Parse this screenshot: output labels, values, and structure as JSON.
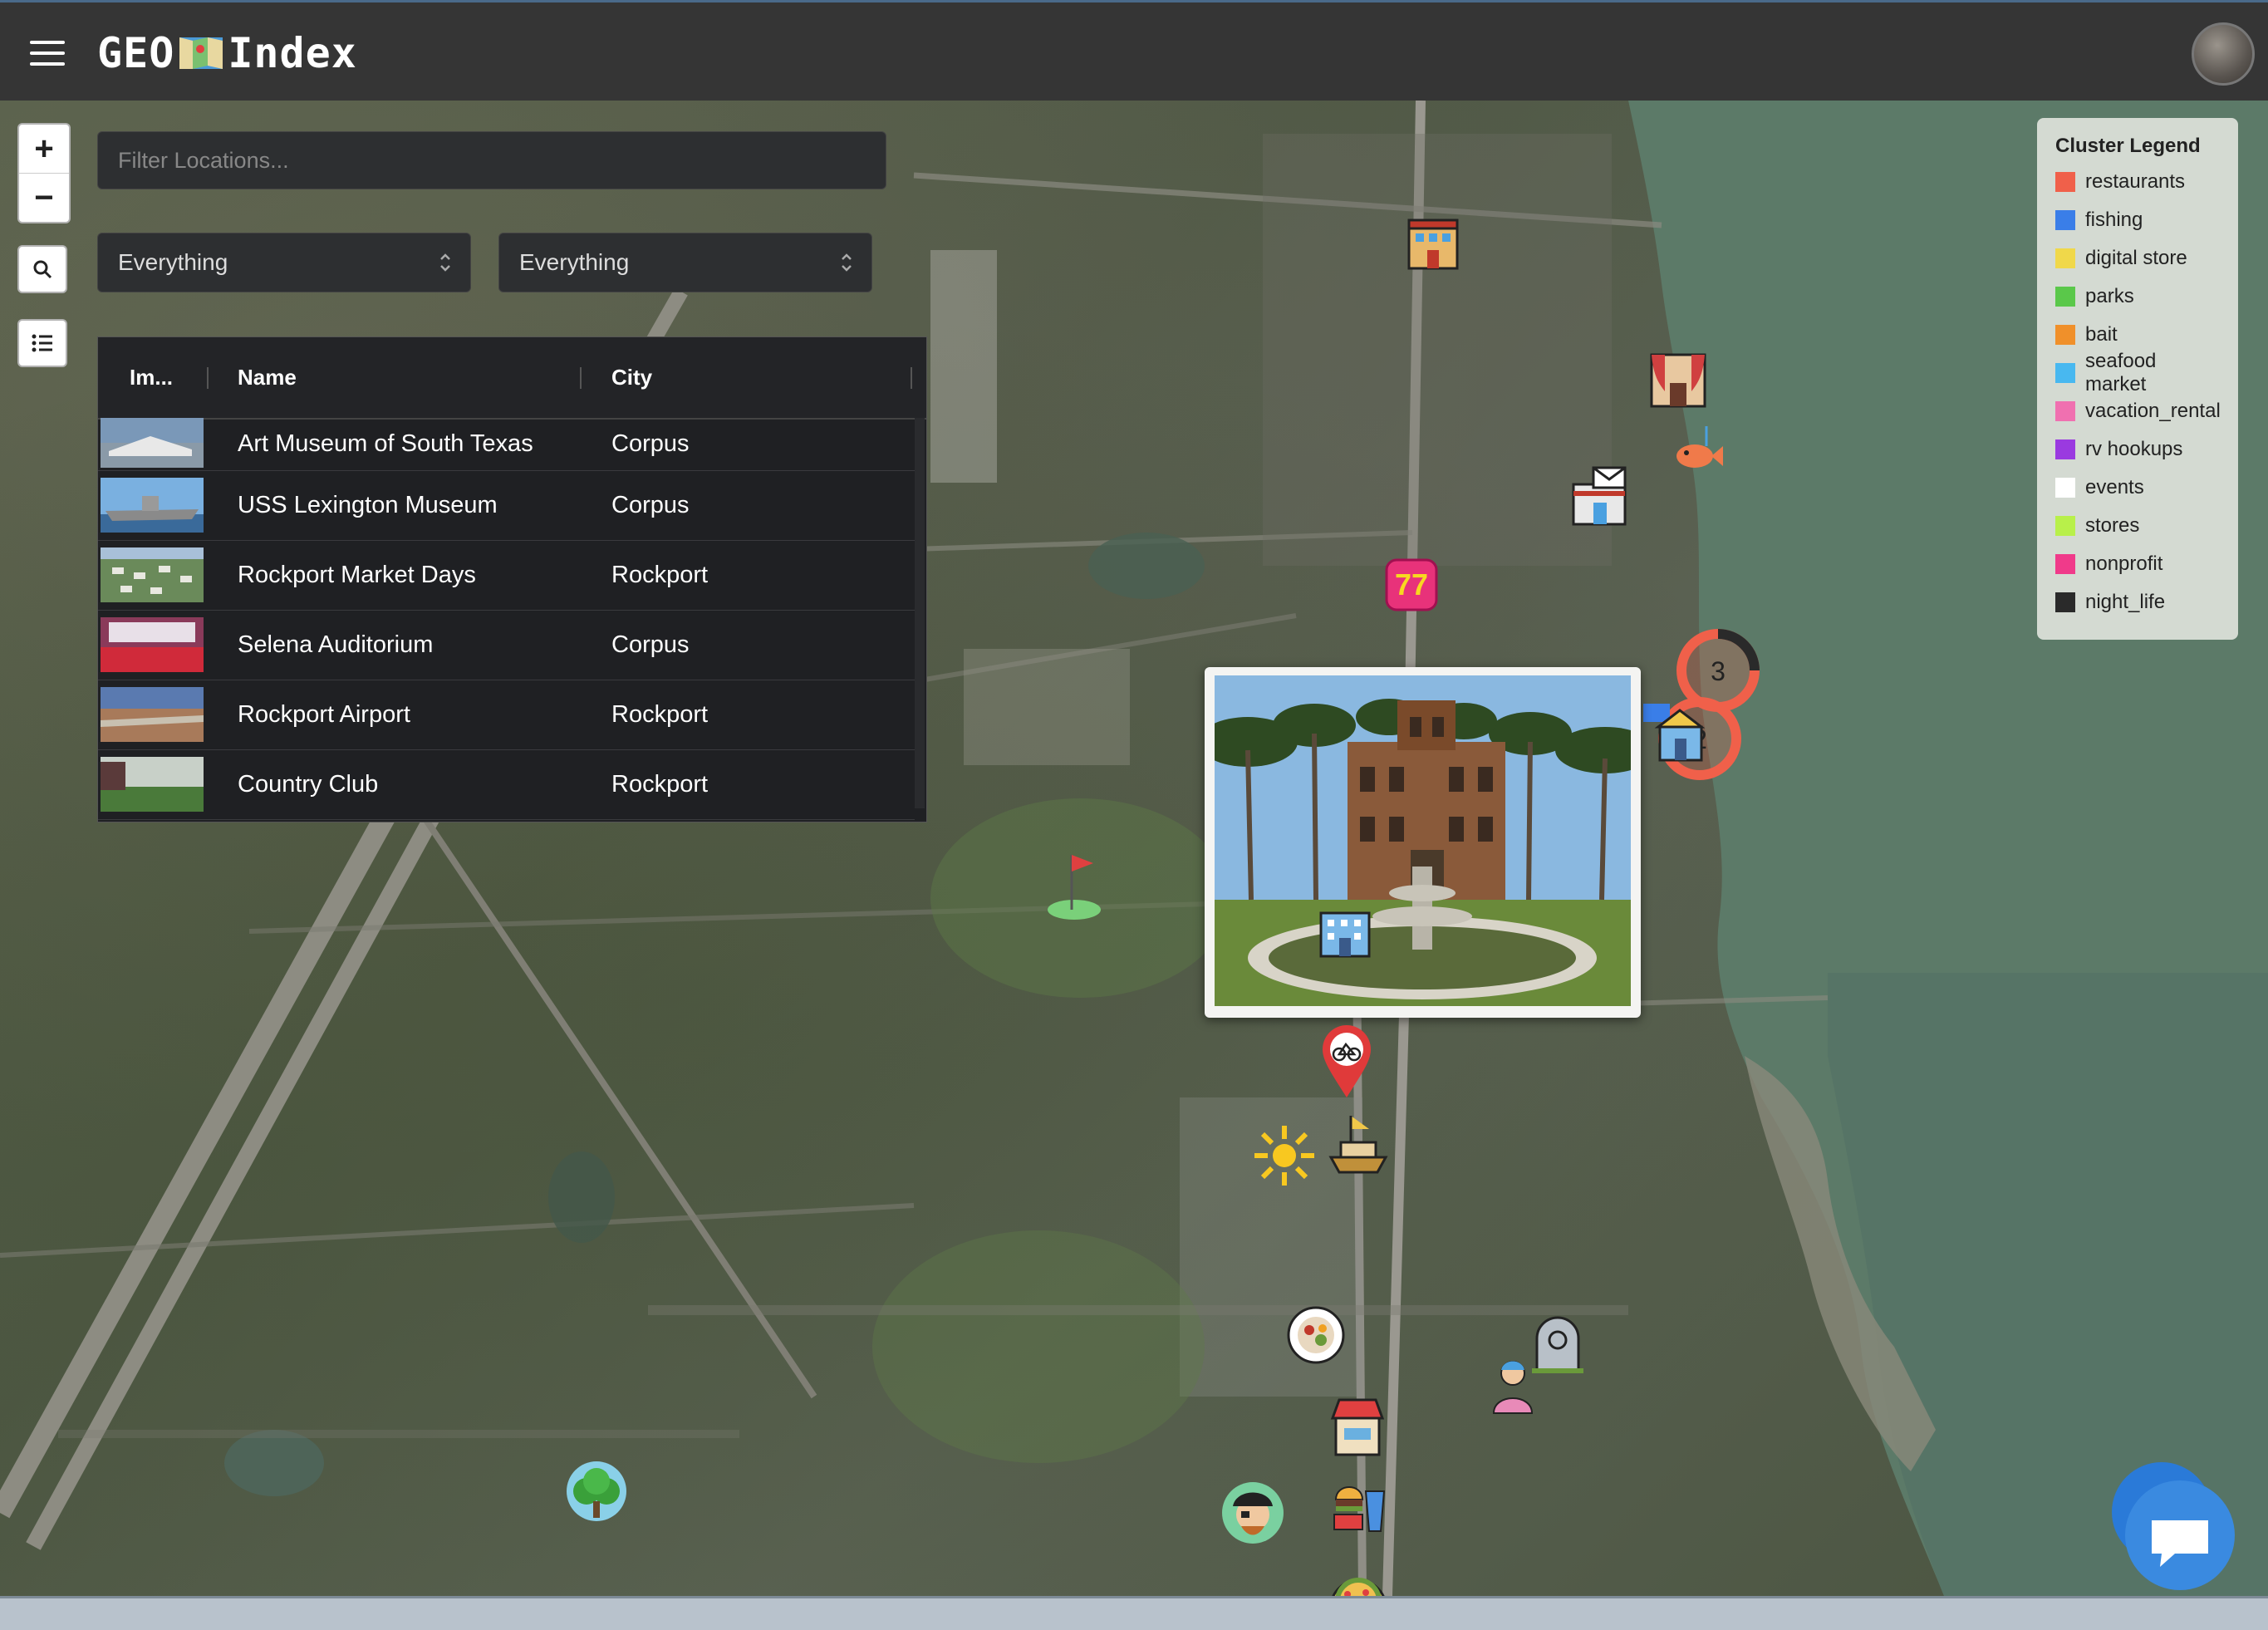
{
  "header": {
    "logo_left": "GEO",
    "logo_right": "Index"
  },
  "icons": {
    "menu": "hamburger-icon",
    "zoom_in": "plus-icon",
    "zoom_out": "minus-icon",
    "search": "search-icon",
    "list": "list-icon",
    "chat": "chat-icon",
    "back": "chevron-left-icon"
  },
  "controls": {
    "zoom_in_label": "+",
    "zoom_out_label": "−"
  },
  "filter": {
    "placeholder": "Filter Locations..."
  },
  "selects": [
    {
      "value": "Everything"
    },
    {
      "value": "Everything"
    }
  ],
  "table": {
    "columns": [
      "Im...",
      "Name",
      "City"
    ],
    "rows": [
      {
        "name": "Art Museum of South Texas",
        "city": "Corpus"
      },
      {
        "name": "USS Lexington Museum",
        "city": "Corpus"
      },
      {
        "name": "Rockport Market Days",
        "city": "Rockport"
      },
      {
        "name": "Selena Auditorium",
        "city": "Corpus"
      },
      {
        "name": "Rockport Airport",
        "city": "Rockport"
      },
      {
        "name": "Country Club",
        "city": "Rockport"
      }
    ]
  },
  "legend": {
    "title": "Cluster Legend",
    "items": [
      {
        "label": "restaurants",
        "color": "#f0604a"
      },
      {
        "label": "fishing",
        "color": "#3a7ee8"
      },
      {
        "label": "digital store",
        "color": "#f0d84a"
      },
      {
        "label": "parks",
        "color": "#5ac84a"
      },
      {
        "label": "bait",
        "color": "#f0902a"
      },
      {
        "label": "seafood market",
        "color": "#48b8f0"
      },
      {
        "label": "vacation_rental",
        "color": "#f070b0"
      },
      {
        "label": "rv hookups",
        "color": "#9a3ae0"
      },
      {
        "label": "events",
        "color": "#ffffff"
      },
      {
        "label": "stores",
        "color": "#b8f04a"
      },
      {
        "label": "nonprofit",
        "color": "#f03a8a"
      },
      {
        "label": "night_life",
        "color": "#2a2a2a"
      }
    ]
  },
  "map": {
    "clusters": [
      {
        "count": "3"
      },
      {
        "count": "2"
      }
    ],
    "badge_label": "77"
  }
}
